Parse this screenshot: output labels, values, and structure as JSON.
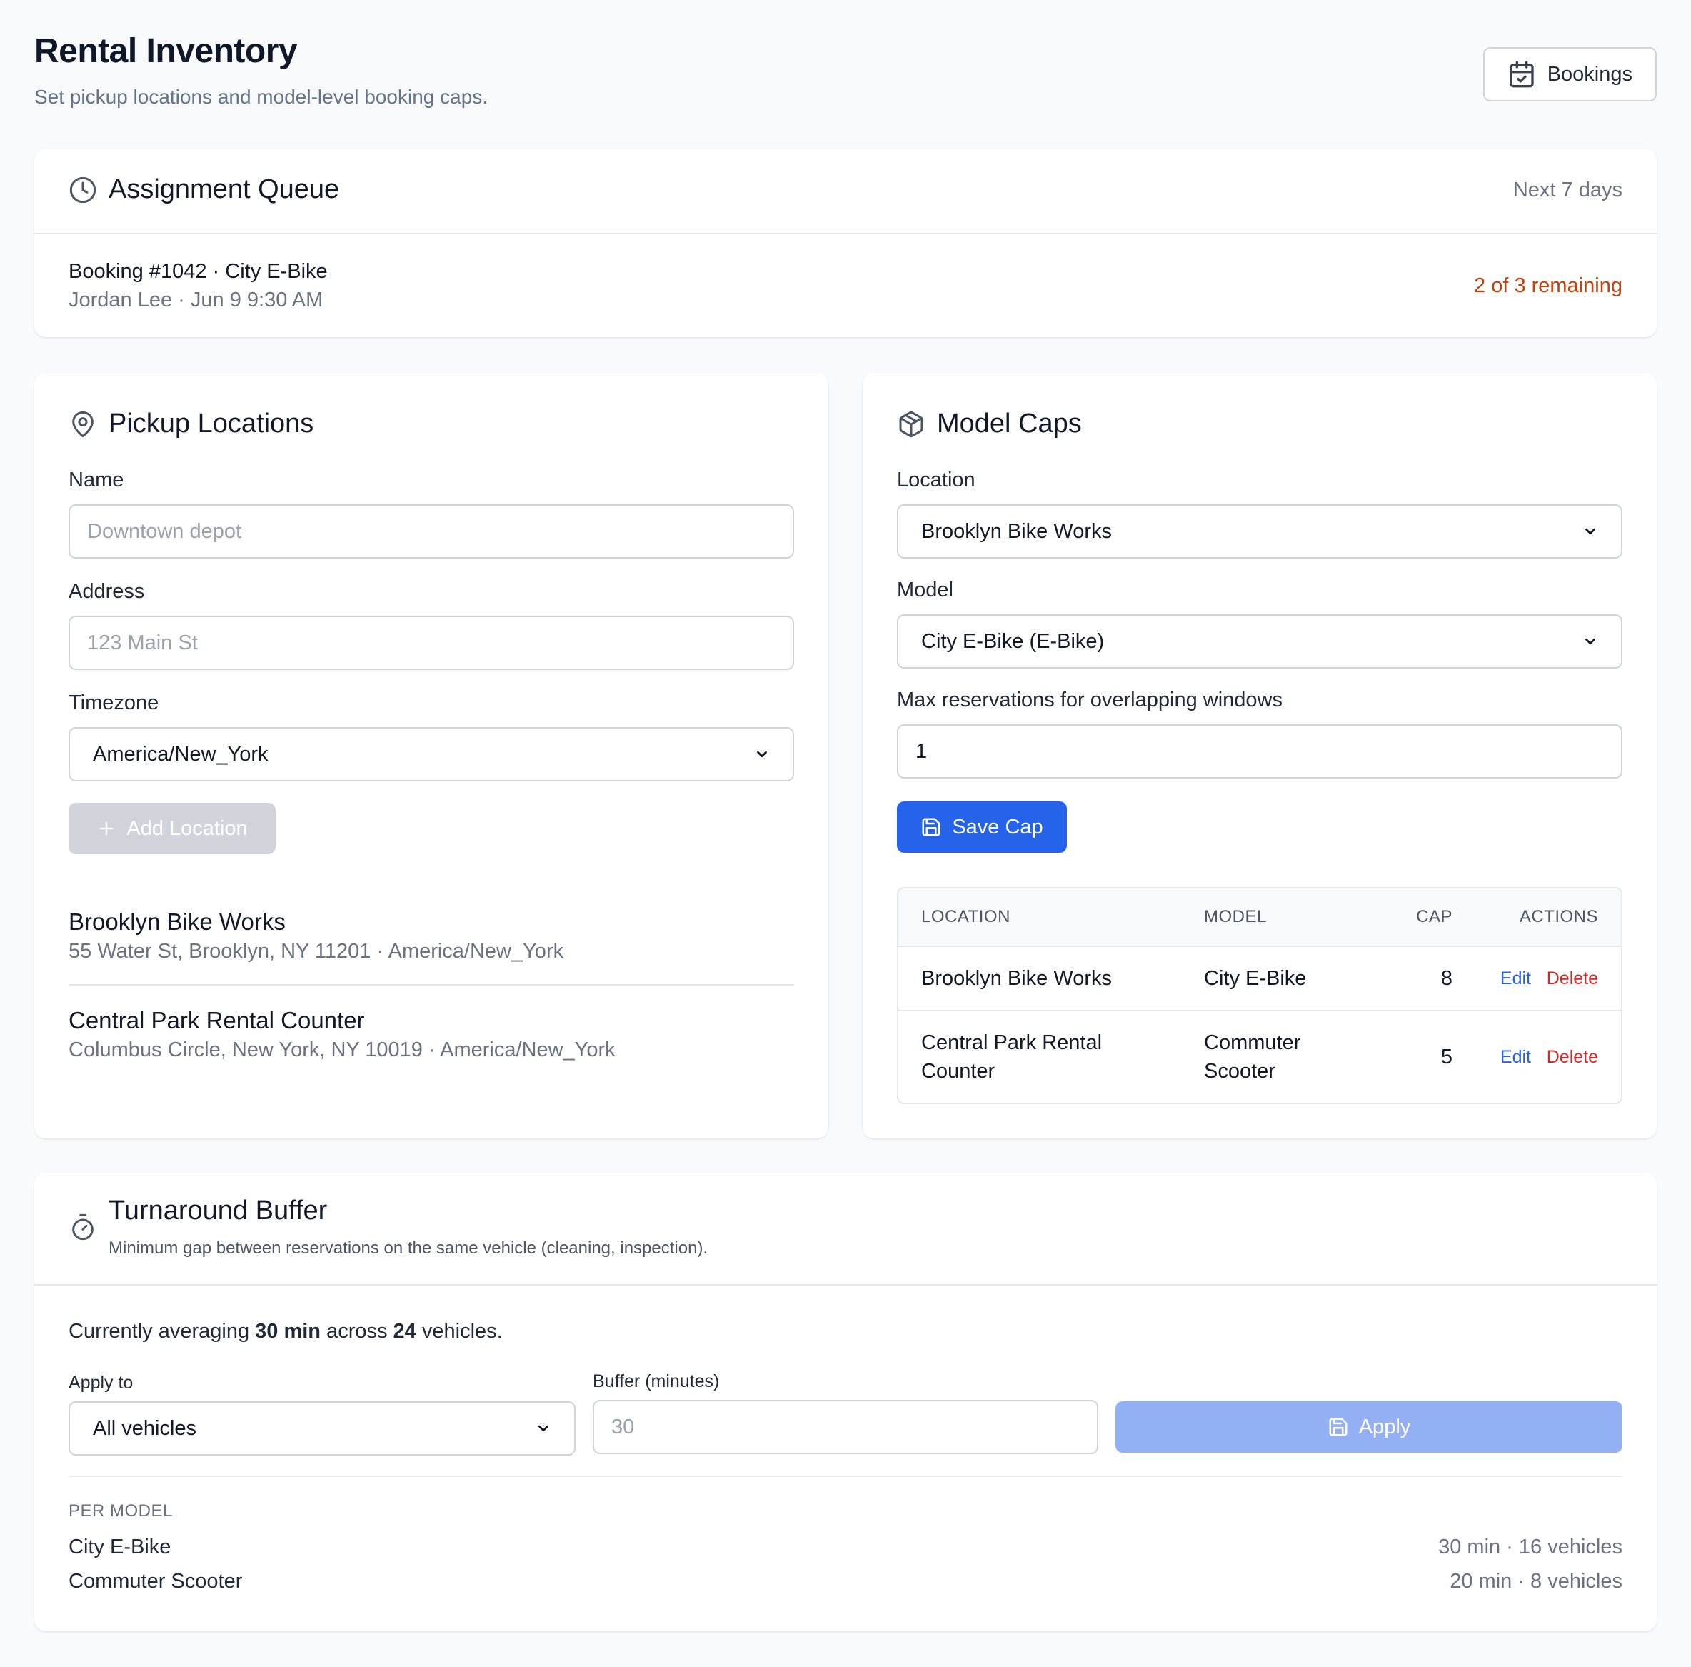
{
  "header": {
    "title": "Rental Inventory",
    "subtitle": "Set pickup locations and model-level booking caps.",
    "bookings_button": "Bookings"
  },
  "queue": {
    "title": "Assignment Queue",
    "range": "Next 7 days",
    "booking_title": "Booking #1042 · City E-Bike",
    "booking_sub": "Jordan Lee · Jun 9 9:30 AM",
    "remaining": "2 of 3 remaining"
  },
  "pickup": {
    "title": "Pickup Locations",
    "name_label": "Name",
    "name_placeholder": "Downtown depot",
    "address_label": "Address",
    "address_placeholder": "123 Main St",
    "timezone_label": "Timezone",
    "timezone_value": "America/New_York",
    "add_button": "Add Location",
    "locations": [
      {
        "name": "Brooklyn Bike Works",
        "meta": "55 Water St, Brooklyn, NY 11201 · America/New_York"
      },
      {
        "name": "Central Park Rental Counter",
        "meta": "Columbus Circle, New York, NY 10019 · America/New_York"
      }
    ]
  },
  "model_caps": {
    "title": "Model Caps",
    "location_label": "Location",
    "location_value": "Brooklyn Bike Works",
    "model_label": "Model",
    "model_value": "City E-Bike (E-Bike)",
    "max_label": "Max reservations for overlapping windows",
    "max_value": "1",
    "save_button": "Save Cap",
    "table": {
      "headers": [
        "LOCATION",
        "MODEL",
        "CAP",
        "ACTIONS"
      ],
      "rows": [
        {
          "location": "Brooklyn Bike Works",
          "model": "City E-Bike",
          "cap": "8",
          "edit": "Edit",
          "delete": "Delete"
        },
        {
          "location_l1": "Central Park Rental",
          "location_l2": "Counter",
          "model_l1": "Commuter",
          "model_l2": "Scooter",
          "cap": "5",
          "edit": "Edit",
          "delete": "Delete"
        }
      ]
    }
  },
  "turnaround": {
    "title": "Turnaround Buffer",
    "description": "Minimum gap between reservations on the same vehicle (cleaning, inspection).",
    "avg_prefix": "Currently averaging ",
    "avg_minutes": "30 min",
    "avg_mid": " across ",
    "avg_vehicles": "24",
    "avg_suffix": " vehicles.",
    "apply_to_label": "Apply to",
    "apply_to_value": "All vehicles",
    "buffer_label": "Buffer (minutes)",
    "buffer_placeholder": "30",
    "apply_button": "Apply",
    "per_model_label": "PER MODEL",
    "per_model": [
      {
        "name": "City E-Bike",
        "value": "30 min · 16 vehicles"
      },
      {
        "name": "Commuter Scooter",
        "value": "20 min · 8 vehicles"
      }
    ]
  }
}
